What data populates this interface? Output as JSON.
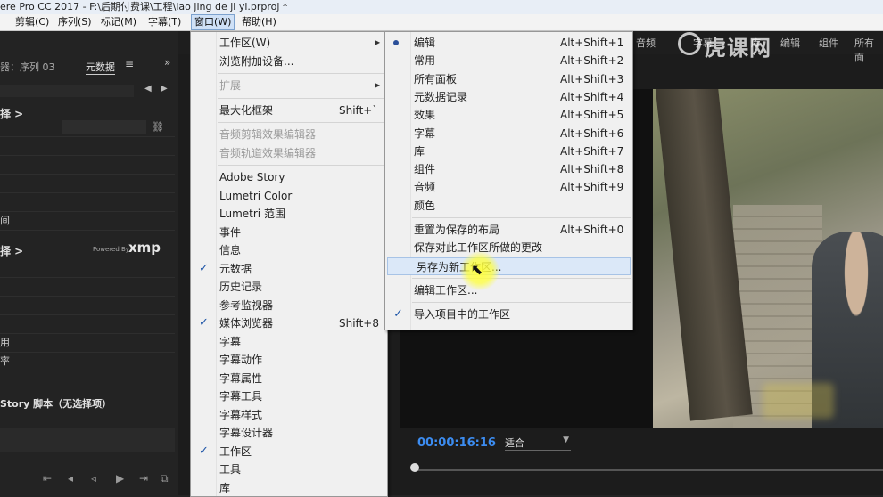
{
  "titlebar": {
    "text": "ere Pro CC 2017 - F:\\后期付费课\\工程\\lao jing de ji yi.prproj *"
  },
  "menubar": [
    {
      "label": "剪辑(C)"
    },
    {
      "label": "序列(S)"
    },
    {
      "label": "标记(M)"
    },
    {
      "label": "字幕(T)"
    },
    {
      "label": "窗口(W)"
    },
    {
      "label": "帮助(H)"
    }
  ],
  "left_panel": {
    "tab_sequence": "器：序列 03",
    "tab_metadata": "元数据",
    "section1": "择 >",
    "row_time": "间",
    "section2": "择 >",
    "powered_by": "Powered By",
    "xmp": "xmp",
    "row_a": "用",
    "row_b": "率",
    "story_script": "Story 脚本（无选择项）"
  },
  "right_tabs": [
    "音频",
    "字幕",
    "库",
    "编辑",
    "组件",
    "所有面"
  ],
  "brand": {
    "text": "虎课网"
  },
  "menu_window": {
    "items": [
      {
        "label": "工作区(W)",
        "submenu": true
      },
      {
        "label": "浏览附加设备..."
      },
      {
        "sep": true
      },
      {
        "label": "扩展",
        "disabled": true,
        "submenu": true
      },
      {
        "sep": true
      },
      {
        "label": "最大化框架",
        "shortcut": "Shift+`"
      },
      {
        "sep": true
      },
      {
        "label": "音频剪辑效果编辑器",
        "disabled": true
      },
      {
        "label": "音频轨道效果编辑器",
        "disabled": true
      },
      {
        "sep": true
      },
      {
        "label": "Adobe Story"
      },
      {
        "label": "Lumetri Color"
      },
      {
        "label": "Lumetri 范围"
      },
      {
        "label": "事件"
      },
      {
        "label": "信息"
      },
      {
        "label": "元数据",
        "checked": true
      },
      {
        "label": "历史记录"
      },
      {
        "label": "参考监视器"
      },
      {
        "label": "媒体浏览器",
        "checked": true,
        "shortcut": "Shift+8"
      },
      {
        "label": "字幕"
      },
      {
        "label": "字幕动作"
      },
      {
        "label": "字幕属性"
      },
      {
        "label": "字幕工具"
      },
      {
        "label": "字幕样式"
      },
      {
        "label": "字幕设计器"
      },
      {
        "label": "工作区",
        "checked": true
      },
      {
        "label": "工具"
      },
      {
        "label": "库"
      }
    ]
  },
  "menu_workspace": {
    "items": [
      {
        "label": "编辑",
        "shortcut": "Alt+Shift+1",
        "bullet": true
      },
      {
        "label": "常用",
        "shortcut": "Alt+Shift+2"
      },
      {
        "label": "所有面板",
        "shortcut": "Alt+Shift+3"
      },
      {
        "label": "元数据记录",
        "shortcut": "Alt+Shift+4"
      },
      {
        "label": "效果",
        "shortcut": "Alt+Shift+5"
      },
      {
        "label": "字幕",
        "shortcut": "Alt+Shift+6"
      },
      {
        "label": "库",
        "shortcut": "Alt+Shift+7"
      },
      {
        "label": "组件",
        "shortcut": "Alt+Shift+8"
      },
      {
        "label": "音频",
        "shortcut": "Alt+Shift+9"
      },
      {
        "label": "颜色"
      },
      {
        "sep": true
      },
      {
        "label": "重置为保存的布局",
        "shortcut": "Alt+Shift+0"
      },
      {
        "label": "保存对此工作区所做的更改"
      },
      {
        "label": "另存为新工作区...",
        "highlighted": true
      },
      {
        "sep": true
      },
      {
        "label": "编辑工作区..."
      },
      {
        "sep": true
      },
      {
        "label": "导入项目中的工作区",
        "checked": true
      }
    ]
  },
  "program_monitor": {
    "timecode": "00:00:16:16",
    "fit": "适合"
  },
  "colors": {
    "timecode": "#3c8cf0",
    "highlight": "#dbe8f8",
    "check": "#1f56a8"
  }
}
